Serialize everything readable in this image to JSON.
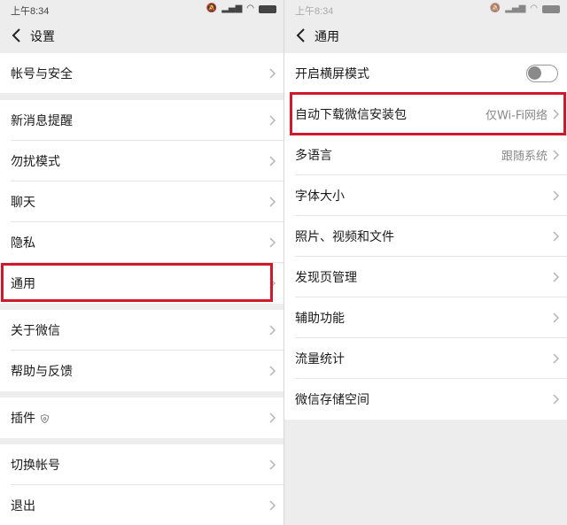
{
  "left": {
    "status": {
      "time": "上午8:34"
    },
    "title": "设置",
    "items": [
      {
        "label": "帐号与安全"
      },
      {
        "label": "新消息提醒"
      },
      {
        "label": "勿扰模式"
      },
      {
        "label": "聊天"
      },
      {
        "label": "隐私"
      },
      {
        "label": "通用"
      },
      {
        "label": "关于微信"
      },
      {
        "label": "帮助与反馈"
      },
      {
        "label": "插件"
      },
      {
        "label": "切换帐号"
      },
      {
        "label": "退出"
      }
    ]
  },
  "right": {
    "status": {
      "time": "上午8:34"
    },
    "title": "通用",
    "items": [
      {
        "label": "开启横屏模式",
        "toggle_on": false
      },
      {
        "label": "自动下载微信安装包",
        "value": "仅Wi-Fi网络"
      },
      {
        "label": "多语言",
        "value": "跟随系统"
      },
      {
        "label": "字体大小"
      },
      {
        "label": "照片、视频和文件"
      },
      {
        "label": "发现页管理"
      },
      {
        "label": "辅助功能"
      },
      {
        "label": "流量统计"
      },
      {
        "label": "微信存储空间"
      }
    ]
  },
  "colors": {
    "highlight": "#d0192c",
    "background": "#ededed",
    "row": "#ffffff"
  }
}
